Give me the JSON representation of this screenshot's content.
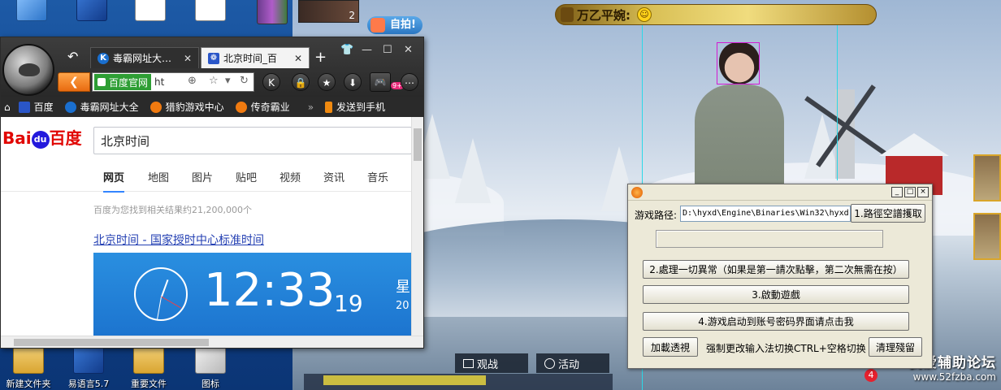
{
  "desktop": {
    "icons": [
      {
        "label": "新建文件夹",
        "icon": "folder-icon"
      },
      {
        "label": "易语言5.7",
        "icon": "easy-language-icon"
      },
      {
        "label": "重要文件",
        "icon": "folder-icon"
      },
      {
        "label": "图标",
        "icon": "folder-icon"
      }
    ]
  },
  "browser": {
    "tabs": [
      {
        "label": "毒霸网址大…",
        "icon": "K"
      },
      {
        "label": "北京时间_百",
        "icon": "baidu-paw-icon"
      }
    ],
    "new_tab": "+",
    "back_tab": "↶",
    "address": {
      "secure_label": "百度官网",
      "url": "ht"
    },
    "favorites": [
      {
        "label": "百度",
        "color": "#2a56c8"
      },
      {
        "label": "毒霸网址大全",
        "color": "#1a6fcf"
      },
      {
        "label": "猎豹游戏中心",
        "color": "#f07a10"
      },
      {
        "label": "传奇霸业",
        "color": "#f07a10"
      }
    ],
    "send_to_phone": "发送到手机",
    "game_badge": "9+",
    "page": {
      "logo_bai": "Bai",
      "logo_du": "du",
      "logo_cn": "百度",
      "search_value": "北京时间",
      "tabs": [
        "网页",
        "地图",
        "图片",
        "贴吧",
        "视频",
        "资讯",
        "音乐"
      ],
      "result_count": "百度为您找到相关结果约21,200,000个",
      "result_title": "北京时间 - 国家授时中心标准时间",
      "clock": {
        "time": "12:33",
        "seconds": "19",
        "day": "星",
        "year": "20"
      }
    }
  },
  "game": {
    "banner_name": "万乙平婉:",
    "banner_emote": "☺",
    "selfie_label": "自拍!",
    "avatar_count": "2",
    "watch_label": "观战",
    "activity_label": "活动",
    "badge_count": "4",
    "watermark_cn": "我爱辅助论坛",
    "watermark_url": "www.52fzba.com"
  },
  "tool": {
    "path_label": "游戏路径:",
    "path_value": "D:\\hyxd\\Engine\\Binaries\\Win32\\hyxd",
    "btn_path": "1.路徑空譜擭取",
    "btn_handle": "2.處理一切異常（如果是第一請次點擊，第二次無需在按）",
    "btn_start": "3.啟動遊戲",
    "btn_click": "4.游戏启动到账号密码界面请点击我",
    "btn_load": "加載透視",
    "hint": "强制更改输入法切换CTRL+空格切换",
    "btn_clean": "清理殘留",
    "progress": 0,
    "controls": [
      "_",
      "□",
      "×"
    ]
  }
}
